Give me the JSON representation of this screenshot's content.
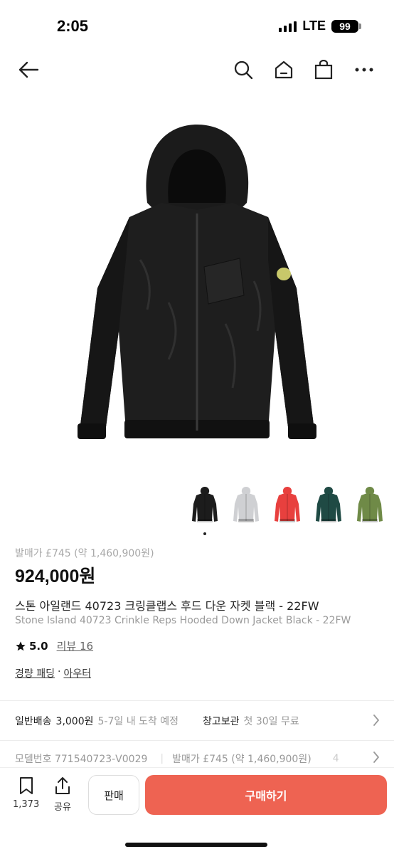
{
  "status": {
    "time": "2:05",
    "network": "LTE",
    "battery": "99"
  },
  "nav": {
    "back_icon": "arrow-left-icon",
    "search_icon": "search-icon",
    "home_icon": "home-icon",
    "bag_icon": "shopping-bag-icon",
    "more_icon": "more-horizontal-icon"
  },
  "colors": {
    "accent": "#ee6352",
    "text": "#222222",
    "muted": "#999999"
  },
  "thumbnails": [
    {
      "color": "#1c1c1c",
      "label": "black",
      "selected": true
    },
    {
      "color": "#cfd0d3",
      "label": "grey",
      "selected": false
    },
    {
      "color": "#e8403e",
      "label": "red",
      "selected": false
    },
    {
      "color": "#1f4a44",
      "label": "green",
      "selected": false
    },
    {
      "color": "#6f8a47",
      "label": "olive",
      "selected": false
    }
  ],
  "product": {
    "original_price": "발매가 £745 (약 1,460,900원)",
    "price": "924,000원",
    "title_ko": "스톤 아일랜드 40723 크링클랩스 후드 다운 자켓 블랙 - 22FW",
    "title_en": "Stone Island 40723 Crinkle Reps Hooded Down Jacket Black - 22FW",
    "rating": "5.0",
    "review_label": "리뷰 16",
    "category_1": "경량 패딩",
    "category_sep": "·",
    "category_2": "아우터"
  },
  "shipping": {
    "label": "일반배송",
    "fee": "3,000원",
    "eta": "5-7일 내 도착 예정",
    "storage_label": "창고보관",
    "storage_note": "첫 30일 무료"
  },
  "info": {
    "model": "모델번호 771540723-V0029",
    "release": "발매가 £745 (약 1,460,900원)",
    "trailing": "4"
  },
  "bottom": {
    "wish_count": "1,373",
    "share_label": "공유",
    "sell_label": "판매",
    "buy_label": "구매하기"
  }
}
